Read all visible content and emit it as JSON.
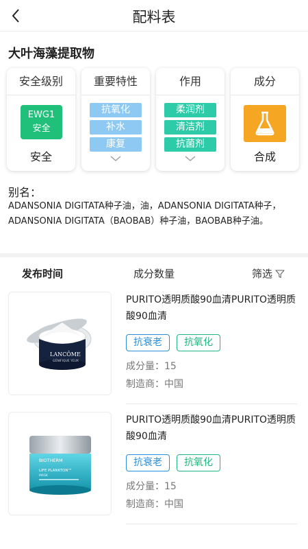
{
  "header": {
    "title": "配料表",
    "back_icon": "chevron-left-icon"
  },
  "ingredient": {
    "name": "大叶海藻提取物"
  },
  "cards": {
    "safety": {
      "title": "安全级别",
      "badge_line1": "EWG1",
      "badge_line2": "安全",
      "label": "安全",
      "color": "#21c07a"
    },
    "traits": {
      "title": "重要特性",
      "tags": [
        "抗氧化",
        "补水",
        "康复"
      ],
      "color": "#8ec9f3"
    },
    "effects": {
      "title": "作用",
      "tags": [
        "柔润剂",
        "清洁剂",
        "抗菌剂"
      ],
      "color": "#2dcba8"
    },
    "composition": {
      "title": "成分",
      "label": "合成",
      "icon": "flask-icon",
      "color": "#f5a623"
    }
  },
  "alias": {
    "label": "别名：",
    "text": "ADANSONIA DIGITATA种子油，油，ADANSONIA DIGITATA种子，ADANSONIA DIGITATA（BAOBAB）种子油，BAOBAB种子油。"
  },
  "filters": {
    "sort_time": "发布时间",
    "sort_count": "成分数量",
    "filter": "筛选"
  },
  "products": [
    {
      "title": "PURITO透明质酸90血清PURITO透明质酸90血清",
      "tags": [
        "抗衰老",
        "抗氧化"
      ],
      "count": "成分量：15",
      "maker": "制造商：中国",
      "image_brand": "LANCÔME",
      "image_sub": "GÉNIFIQUE YEUX"
    },
    {
      "title": "PURITO透明质酸90血清PURITO透明质酸90血清",
      "tags": [
        "抗衰老",
        "抗氧化"
      ],
      "count": "成分量：15",
      "maker": "制造商：中国",
      "image_brand": "BIOTHERM",
      "image_sub": "LIFE PLANKTON™",
      "image_sub2": "MASK"
    }
  ]
}
